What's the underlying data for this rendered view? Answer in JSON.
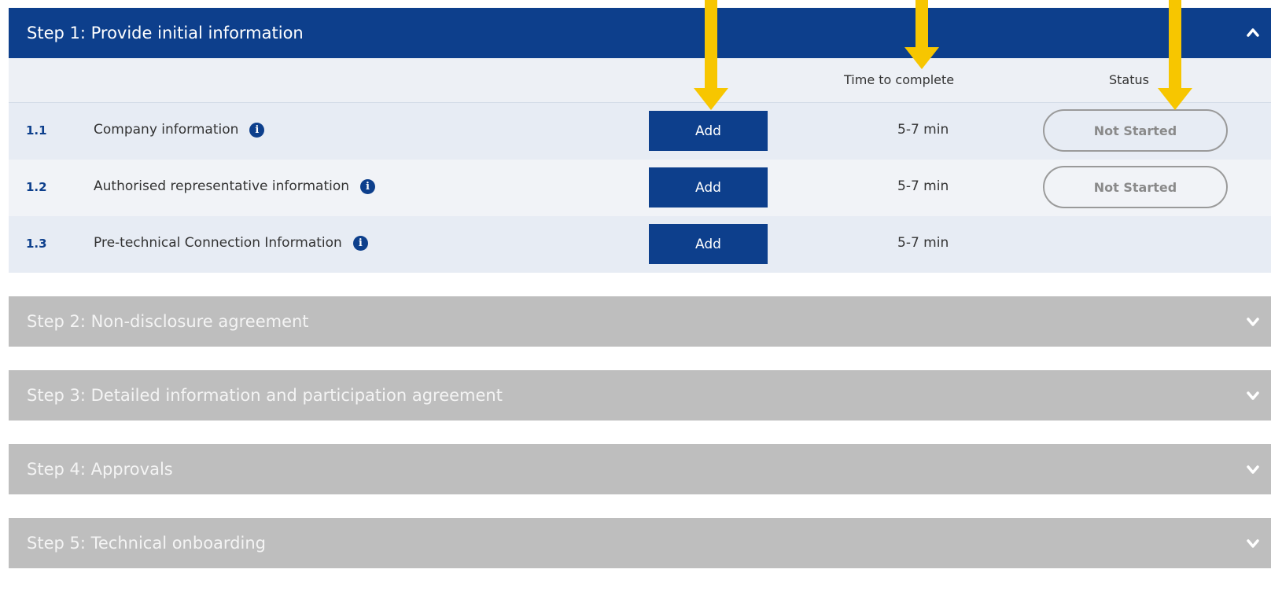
{
  "steps": [
    {
      "label": "Step 1: Provide initial information",
      "expanded": true
    },
    {
      "label": "Step 2: Non-disclosure agreement",
      "expanded": false
    },
    {
      "label": "Step 3: Detailed information and participation agreement",
      "expanded": false
    },
    {
      "label": "Step 4: Approvals",
      "expanded": false
    },
    {
      "label": "Step 5: Technical onboarding",
      "expanded": false
    }
  ],
  "columns": {
    "time": "Time to complete",
    "status": "Status"
  },
  "tasks": [
    {
      "number": "1.1",
      "name": "Company information",
      "action": "Add",
      "time": "5-7 min",
      "status": "Not Started"
    },
    {
      "number": "1.2",
      "name": "Authorised representative information",
      "action": "Add",
      "time": "5-7 min",
      "status": "Not Started"
    },
    {
      "number": "1.3",
      "name": "Pre-technical Connection Information",
      "action": "Add",
      "time": "5-7 min",
      "status": ""
    }
  ],
  "info_glyph": "i",
  "colors": {
    "primary": "#0d3f8c",
    "inactive_header": "#bebebe",
    "annotation_arrow": "#f7c600"
  }
}
